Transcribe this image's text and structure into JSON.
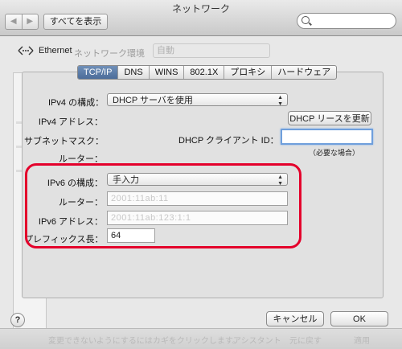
{
  "window": {
    "title": "ネットワーク"
  },
  "toolbar": {
    "back_glyph": "◀",
    "forward_glyph": "▶",
    "show_all_label": "すべてを表示",
    "search_placeholder": ""
  },
  "background": {
    "location_label": "ネットワーク環境",
    "location_value": "自動",
    "bottom_hint": "変更できないようにするにはカギをクリックします。",
    "assistant_label": "アシスタント",
    "revert_label": "元に戻す",
    "apply_label": "適用"
  },
  "sheet": {
    "interface_name": "Ethernet",
    "tabs": [
      {
        "label": "TCP/IP",
        "active": true
      },
      {
        "label": "DNS",
        "active": false
      },
      {
        "label": "WINS",
        "active": false
      },
      {
        "label": "802.1X",
        "active": false
      },
      {
        "label": "プロキシ",
        "active": false
      },
      {
        "label": "ハードウェア",
        "active": false
      }
    ],
    "ipv4_config_label": "IPv4 の構成：",
    "ipv4_config_value": "DHCP サーバを使用",
    "ipv4_address_label": "IPv4 アドレス：",
    "dhcp_renew_button": "DHCP リースを更新",
    "subnet_mask_label": "サブネットマスク：",
    "dhcp_client_id_label": "DHCP クライアント ID：",
    "dhcp_client_id_value": "",
    "dhcp_client_id_note": "（必要な場合）",
    "router_label": "ルーター：",
    "ipv6_config_label": "IPv6 の構成：",
    "ipv6_config_value": "手入力",
    "ipv6_router_label": "ルーター：",
    "ipv6_router_value": "2001:11ab:11",
    "ipv6_address_label": "IPv6 アドレス：",
    "ipv6_address_value": "2001:11ab:123:1:1",
    "prefix_length_label": "プレフィックス長：",
    "prefix_length_value": "64",
    "cancel_button": "キャンセル",
    "ok_button": "OK",
    "help_glyph": "?"
  },
  "colors": {
    "highlight": "#e4002b",
    "active_tab": "#4c6d9a",
    "focus_ring": "#6f9fdc"
  }
}
